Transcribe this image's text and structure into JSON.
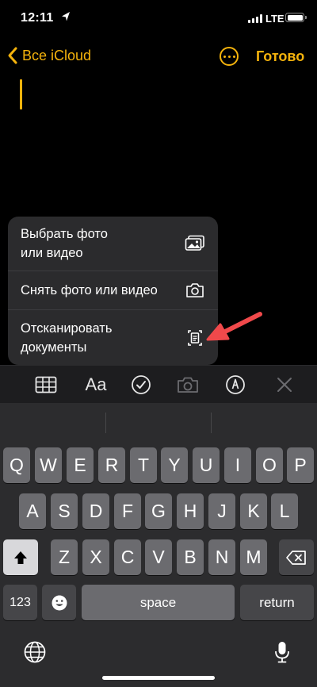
{
  "status_bar": {
    "time": "12:11",
    "network": "LTE"
  },
  "nav": {
    "back_label": "Все iCloud",
    "done_label": "Готово"
  },
  "menu": {
    "items": [
      {
        "label": "Выбрать фото\nили видео",
        "icon": "photo-library-icon"
      },
      {
        "label": "Снять фото или видео",
        "icon": "camera-icon"
      },
      {
        "label": "Отсканировать\nдокументы",
        "icon": "document-scanner-icon"
      }
    ]
  },
  "toolbar": {
    "format_label": "Aa",
    "icons": [
      "table-icon",
      "text-format-icon",
      "checklist-icon",
      "camera-icon",
      "markup-pen-icon",
      "close-icon"
    ]
  },
  "keyboard": {
    "row1": [
      "Q",
      "W",
      "E",
      "R",
      "T",
      "Y",
      "U",
      "I",
      "O",
      "P"
    ],
    "row2": [
      "A",
      "S",
      "D",
      "F",
      "G",
      "H",
      "J",
      "K",
      "L"
    ],
    "row3": [
      "Z",
      "X",
      "C",
      "V",
      "B",
      "N",
      "M"
    ],
    "numbers_label": "123",
    "space_label": "space",
    "return_label": "return"
  },
  "colors": {
    "accent": "#f5b30c",
    "arrow": "#f0494b",
    "background": "#000000"
  }
}
